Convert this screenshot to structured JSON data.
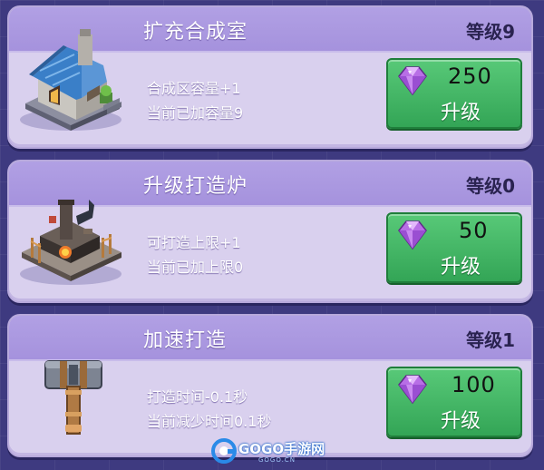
{
  "cards": [
    {
      "title": "扩充合成室",
      "level": "等级9",
      "desc_line1": "合成区容量+1",
      "desc_line2": "当前已加容量9",
      "cost": "250",
      "button_label": "升级",
      "art_icon": "stone-house-icon",
      "currency_icon": "purple-gem-icon"
    },
    {
      "title": "升级打造炉",
      "level": "等级0",
      "desc_line1": "可打造上限+1",
      "desc_line2": "当前已加上限0",
      "cost": "50",
      "button_label": "升级",
      "art_icon": "forge-building-icon",
      "currency_icon": "purple-gem-icon"
    },
    {
      "title": "加速打造",
      "level": "等级1",
      "desc_line1": "打造时间-0.1秒",
      "desc_line2": "当前减少时间0.1秒",
      "cost": "100",
      "button_label": "升级",
      "art_icon": "hammer-icon",
      "currency_icon": "purple-gem-icon"
    }
  ],
  "watermark": {
    "text": "GOGO手游网",
    "subtext": "GOGO.CN"
  },
  "colors": {
    "background": "#3e3a80",
    "card_body": "#d9d0ee",
    "card_header": "#a592dd",
    "button_green": "#33a556",
    "gem_purple": "#b86ee6"
  }
}
